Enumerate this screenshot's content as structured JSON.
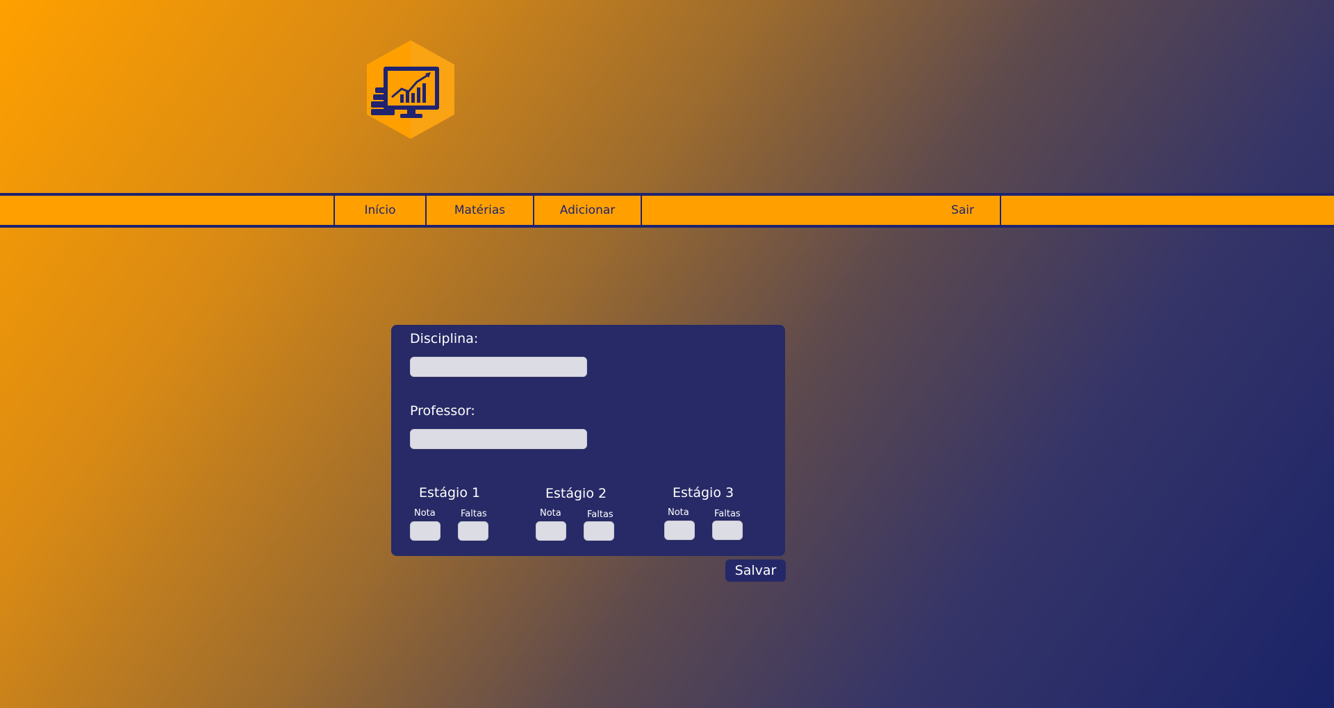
{
  "nav": {
    "items": [
      {
        "label": "Início"
      },
      {
        "label": "Matérias"
      },
      {
        "label": "Adicionar"
      }
    ],
    "logout_label": "Sair"
  },
  "form": {
    "discipline_label": "Disciplina:",
    "discipline_value": "",
    "professor_label": "Professor:",
    "professor_value": "",
    "stages": [
      {
        "title": "Estágio 1",
        "grade_label": "Nota",
        "absences_label": "Faltas",
        "grade_value": "",
        "absences_value": ""
      },
      {
        "title": "Estágio 2",
        "grade_label": "Nota",
        "absences_label": "Faltas",
        "grade_value": "",
        "absences_value": ""
      },
      {
        "title": "Estágio 3",
        "grade_label": "Nota",
        "absences_label": "Faltas",
        "grade_value": "",
        "absences_value": ""
      }
    ],
    "save_label": "Salvar"
  },
  "logo": {
    "icon": "monitor-chart-books-icon"
  },
  "colors": {
    "accent": "#FFA000",
    "navy": "#1F2370",
    "card": "#272A66",
    "input": "#DCDCE4"
  }
}
